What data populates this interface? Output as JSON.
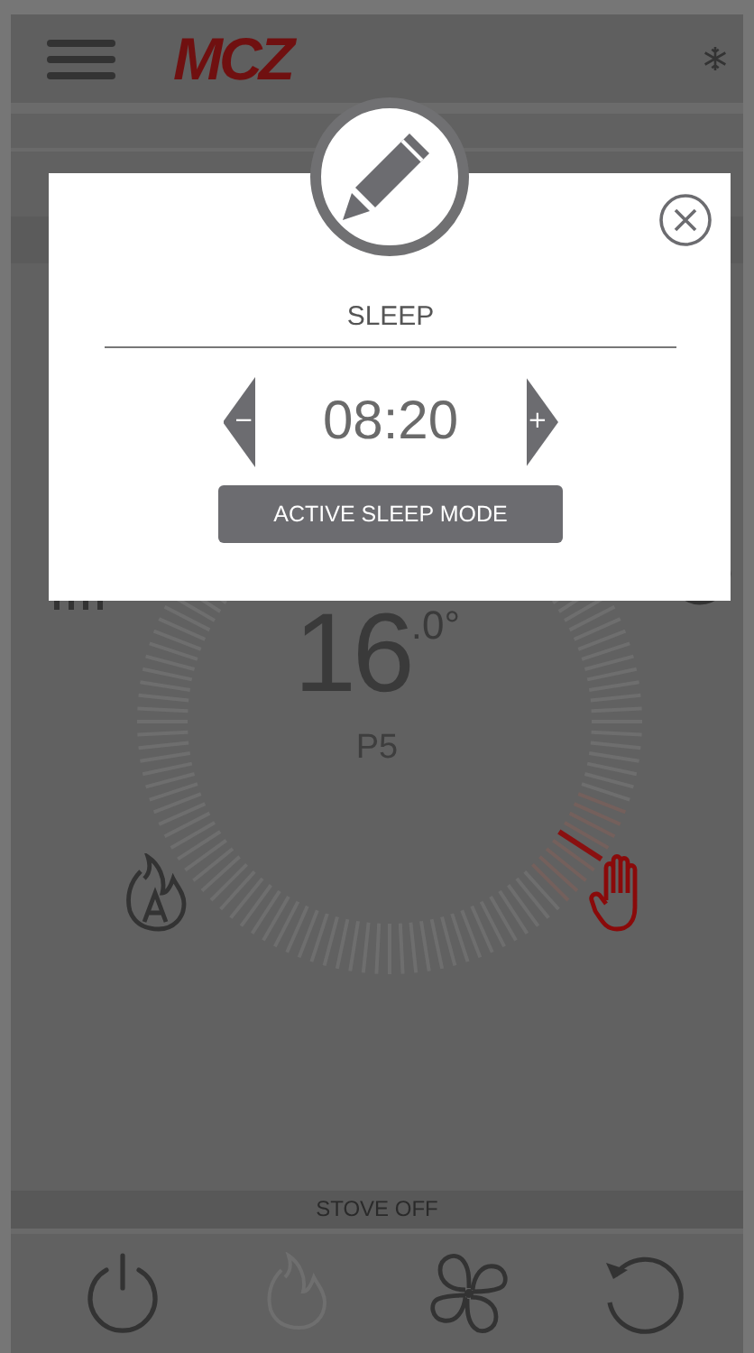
{
  "header": {
    "logo": "MCZ"
  },
  "dialog": {
    "title": "SLEEP",
    "decrease": "−",
    "time": "08:20",
    "increase": "+",
    "button": "ACTIVE SLEEP MODE"
  },
  "dial": {
    "temperature": "16",
    "decimal": ".0°",
    "power": "P5"
  },
  "modes": [
    {
      "kind": "auto",
      "selected": false
    },
    {
      "kind": "manual",
      "selected": true
    }
  ],
  "status": "STOVE OFF",
  "toolbar": [
    {
      "kind": "power",
      "disabled": false
    },
    {
      "kind": "flame",
      "disabled": true
    },
    {
      "kind": "fan",
      "disabled": false
    },
    {
      "kind": "undo",
      "disabled": false
    }
  ]
}
